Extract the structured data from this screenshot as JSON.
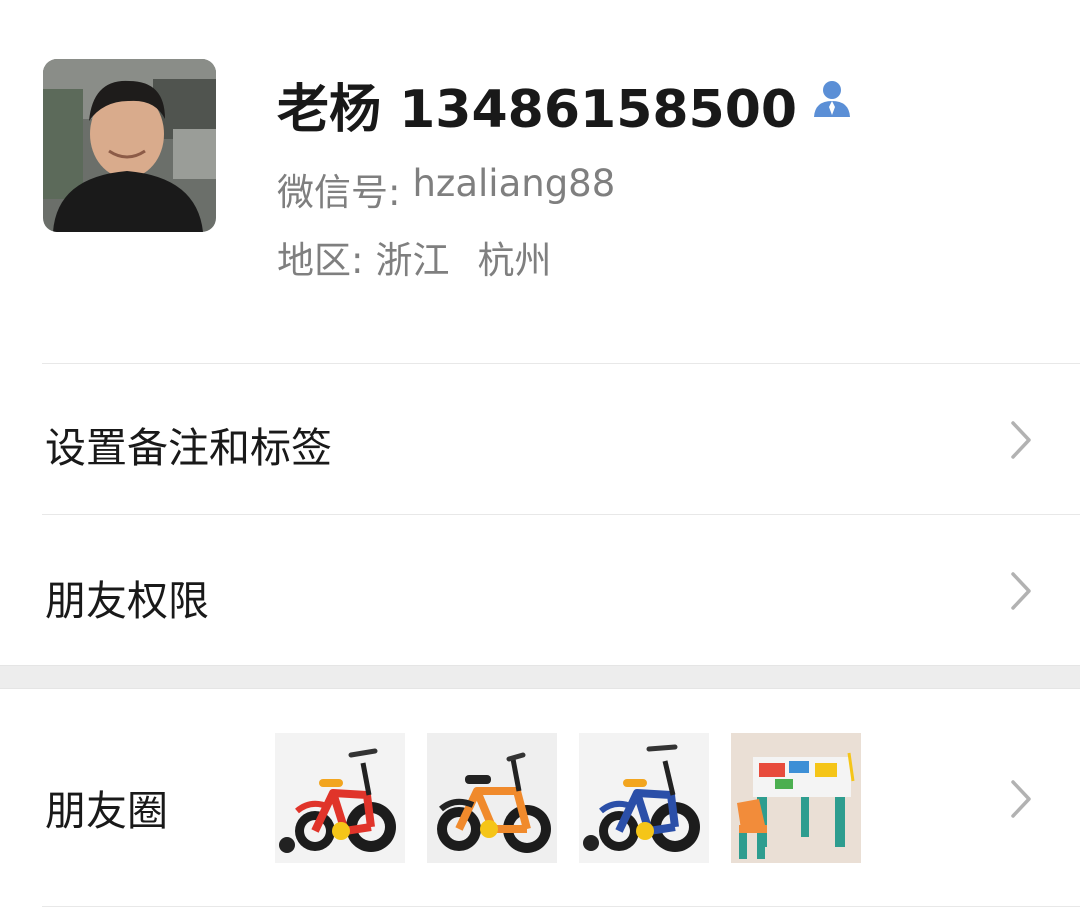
{
  "profile": {
    "display_name": "老杨 13486158500",
    "wechat_id_label": "微信号:",
    "wechat_id_value": "hzaliang88",
    "region_label": "地区:",
    "region_province": "浙江",
    "region_city": "杭州",
    "avatar_icon": "user-avatar-photo",
    "contact_badge_icon": "person-icon",
    "contact_badge_color": "#5b8fd6"
  },
  "menu": {
    "remarks_tags_label": "设置备注和标签",
    "friend_permissions_label": "朋友权限",
    "moments_label": "朋友圈"
  },
  "moments": {
    "thumbnails": [
      {
        "icon": "red-kids-bicycle",
        "color": "#e0342a"
      },
      {
        "icon": "orange-kids-bicycle",
        "color": "#f08a2c"
      },
      {
        "icon": "blue-kids-bicycle",
        "color": "#2b4fa8"
      },
      {
        "icon": "toy-building-table",
        "color": "#f28c3a"
      }
    ]
  },
  "icons": {
    "chevron": "chevron-right-icon"
  }
}
